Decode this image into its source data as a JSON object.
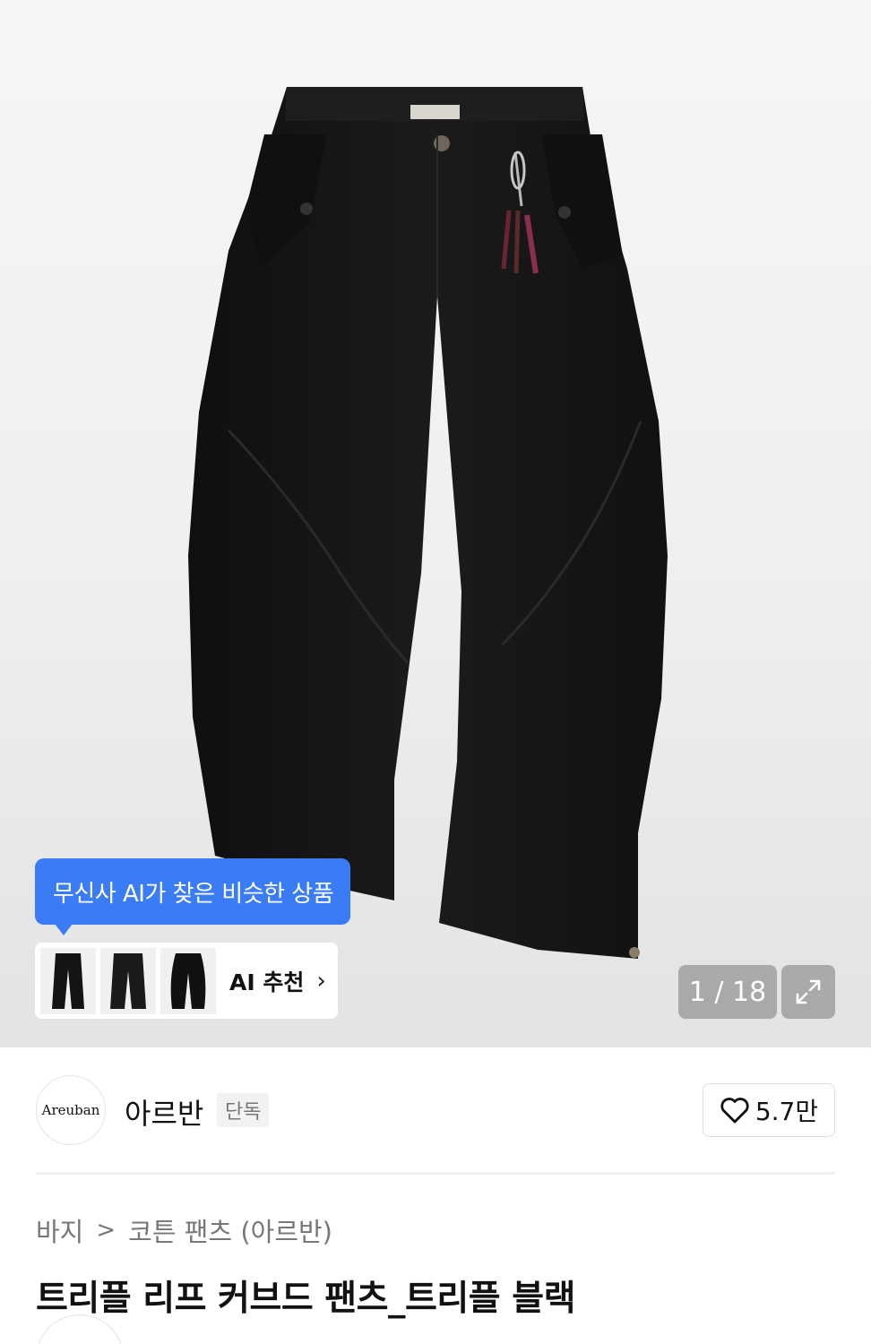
{
  "gallery": {
    "image_alt": "black curved pants product photo",
    "counter": "1 / 18",
    "expand_icon": "expand-icon"
  },
  "ai_similar": {
    "tooltip": "무신사 AI가 찾은 비슷한 상품",
    "recommend_label": "AI 추천",
    "chevron": "›",
    "thumbnails": [
      "pants-thumbnail-1",
      "pants-thumbnail-2",
      "pants-thumbnail-3"
    ]
  },
  "brand": {
    "logo_text": "Areuban",
    "name": "아르반",
    "tag": "단독",
    "likes": "5.7만"
  },
  "breadcrumb": {
    "category": "바지",
    "separator": ">",
    "subcategory": "코튼 팬츠 (아르반)"
  },
  "product": {
    "title": "트리플 리프 커브드 팬츠_트리플 블랙"
  },
  "colors": {
    "accent": "#3a7cf6",
    "hero_bg": "#efeff0",
    "pants": "#161616"
  }
}
